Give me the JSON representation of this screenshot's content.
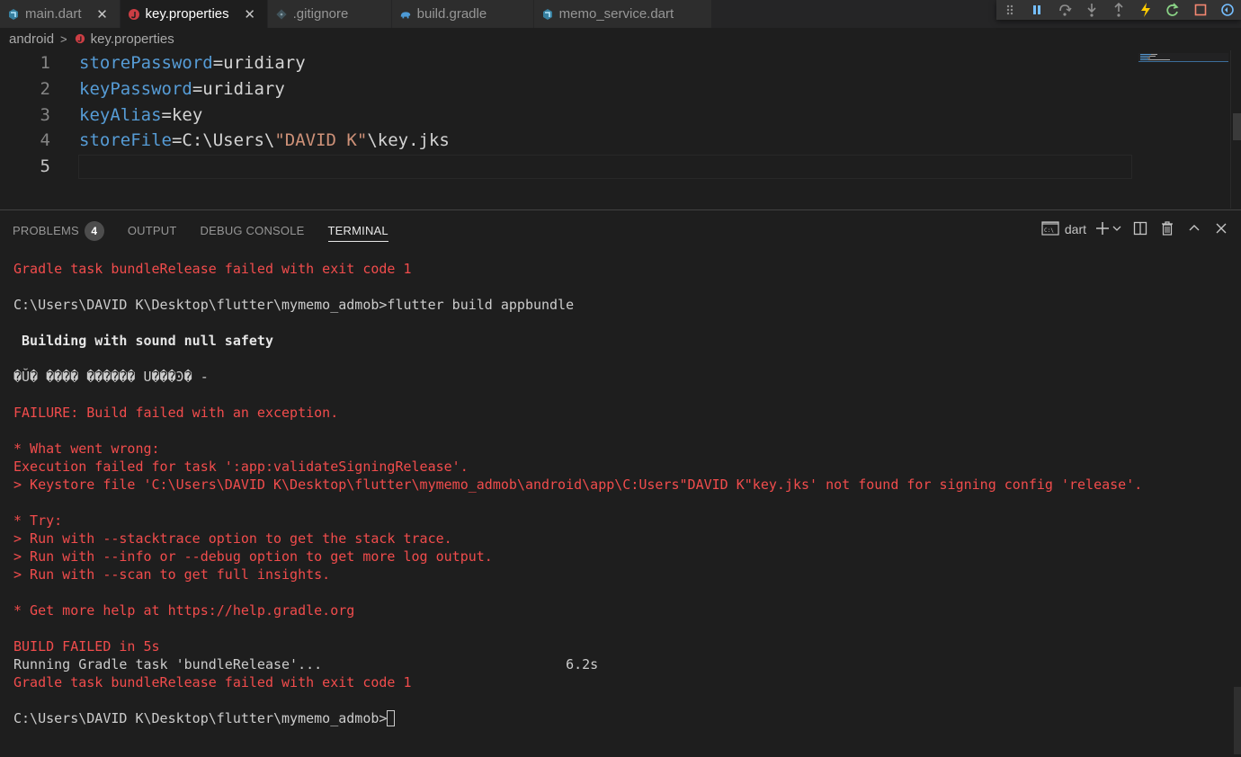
{
  "tabs": [
    {
      "label": "main.dart",
      "icon": "dart-icon",
      "active": false,
      "close": "✕"
    },
    {
      "label": "key.properties",
      "icon": "java-properties-icon",
      "active": true,
      "close": "✕"
    },
    {
      "label": ".gitignore",
      "icon": "git-icon",
      "active": false,
      "close": ""
    },
    {
      "label": "build.gradle",
      "icon": "gradle-elephant-icon",
      "active": false,
      "close": ""
    },
    {
      "label": "memo_service.dart",
      "icon": "dart-icon",
      "active": false,
      "close": ""
    }
  ],
  "debug_toolbar": [
    "drag-handle-icon",
    "pause-icon",
    "step-over-icon",
    "step-into-icon",
    "step-out-icon",
    "hot-reload-icon",
    "restart-icon",
    "stop-icon",
    "devtools-icon"
  ],
  "breadcrumb": {
    "folder": "android",
    "file": "key.properties"
  },
  "editor": {
    "lines": [
      {
        "num": "1",
        "key": "storePassword",
        "eq": "=",
        "value": "uridiary",
        "str": "",
        "tail": ""
      },
      {
        "num": "2",
        "key": "keyPassword",
        "eq": "=",
        "value": "uridiary",
        "str": "",
        "tail": ""
      },
      {
        "num": "3",
        "key": "keyAlias",
        "eq": "=",
        "value": "key",
        "str": "",
        "tail": ""
      },
      {
        "num": "4",
        "key": "storeFile",
        "eq": "=",
        "value": "C:\\Users\\",
        "str": "\"DAVID K\"",
        "tail": "\\key.jks"
      },
      {
        "num": "5",
        "key": "",
        "eq": "",
        "value": "",
        "str": "",
        "tail": ""
      }
    ],
    "current_line": 5
  },
  "panel": {
    "tabs": [
      {
        "label": "PROBLEMS",
        "badge": "4",
        "active": false
      },
      {
        "label": "OUTPUT",
        "badge": "",
        "active": false
      },
      {
        "label": "DEBUG CONSOLE",
        "badge": "",
        "active": false
      },
      {
        "label": "TERMINAL",
        "badge": "",
        "active": true
      }
    ],
    "terminal_name": "dart",
    "actions": [
      "terminal-icon",
      "add-icon",
      "chevron-down-icon",
      "split-icon",
      "trash-icon",
      "chevron-up-icon",
      "close-icon"
    ]
  },
  "terminal": {
    "lines": [
      {
        "text": "Gradle task bundleRelease failed with exit code 1",
        "style": "err"
      },
      {
        "text": "",
        "style": ""
      },
      {
        "text": "C:\\Users\\DAVID K\\Desktop\\flutter\\mymemo_admob>flutter build appbundle",
        "style": ""
      },
      {
        "text": "",
        "style": ""
      },
      {
        "text": " Building with sound null safety",
        "style": "bold"
      },
      {
        "text": "",
        "style": ""
      },
      {
        "text": "�Ŭ� ���� ������ U���Ͽ� -",
        "style": ""
      },
      {
        "text": "",
        "style": ""
      },
      {
        "text": "FAILURE: Build failed with an exception.",
        "style": "err"
      },
      {
        "text": "",
        "style": ""
      },
      {
        "text": "* What went wrong:",
        "style": "err"
      },
      {
        "text": "Execution failed for task ':app:validateSigningRelease'.",
        "style": "err"
      },
      {
        "text": "> Keystore file 'C:\\Users\\DAVID K\\Desktop\\flutter\\mymemo_admob\\android\\app\\C:Users\"DAVID K\"key.jks' not found for signing config 'release'.",
        "style": "err"
      },
      {
        "text": "",
        "style": ""
      },
      {
        "text": "* Try:",
        "style": "err"
      },
      {
        "text": "> Run with --stacktrace option to get the stack trace.",
        "style": "err"
      },
      {
        "text": "> Run with --info or --debug option to get more log output.",
        "style": "err"
      },
      {
        "text": "> Run with --scan to get full insights.",
        "style": "err"
      },
      {
        "text": "",
        "style": ""
      },
      {
        "text": "* Get more help at https://help.gradle.org",
        "style": "err"
      },
      {
        "text": "",
        "style": ""
      },
      {
        "text": "BUILD FAILED in 5s",
        "style": "err"
      },
      {
        "text": "Running Gradle task 'bundleRelease'...                              6.2s",
        "style": ""
      },
      {
        "text": "Gradle task bundleRelease failed with exit code 1",
        "style": "err"
      },
      {
        "text": "",
        "style": ""
      },
      {
        "text": "C:\\Users\\DAVID K\\Desktop\\flutter\\mymemo_admob>",
        "style": "prompt"
      }
    ]
  },
  "colors": {
    "error": "#f14c4c",
    "keyword": "#569cd6",
    "string": "#ce9178",
    "background": "#1e1e1e"
  }
}
